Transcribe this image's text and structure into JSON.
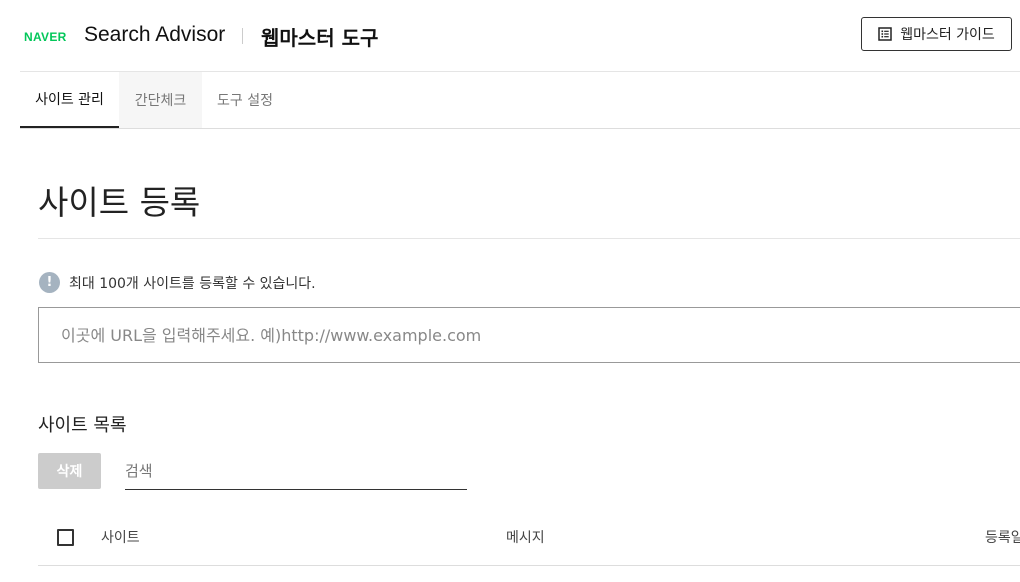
{
  "header": {
    "brand": "NAVER",
    "product": "Search Advisor",
    "tool_title": "웹마스터 도구",
    "guide_button": "웹마스터 가이드"
  },
  "tabs": [
    {
      "label": "사이트 관리",
      "active": true
    },
    {
      "label": "간단체크",
      "active": false
    },
    {
      "label": "도구 설정",
      "active": false
    }
  ],
  "main": {
    "title": "사이트 등록",
    "notice": "최대 100개 사이트를 등록할 수 있습니다.",
    "url_placeholder": "이곳에 URL을 입력해주세요. 예)http://www.example.com",
    "list_title": "사이트 목록",
    "delete_button": "삭제",
    "search_placeholder": "검색",
    "columns": [
      "사이트",
      "메시지",
      "등록일"
    ]
  },
  "colors": {
    "brand_green": "#03c75a",
    "info_icon": "#a5b3c0",
    "disabled_button": "#cccccc"
  }
}
